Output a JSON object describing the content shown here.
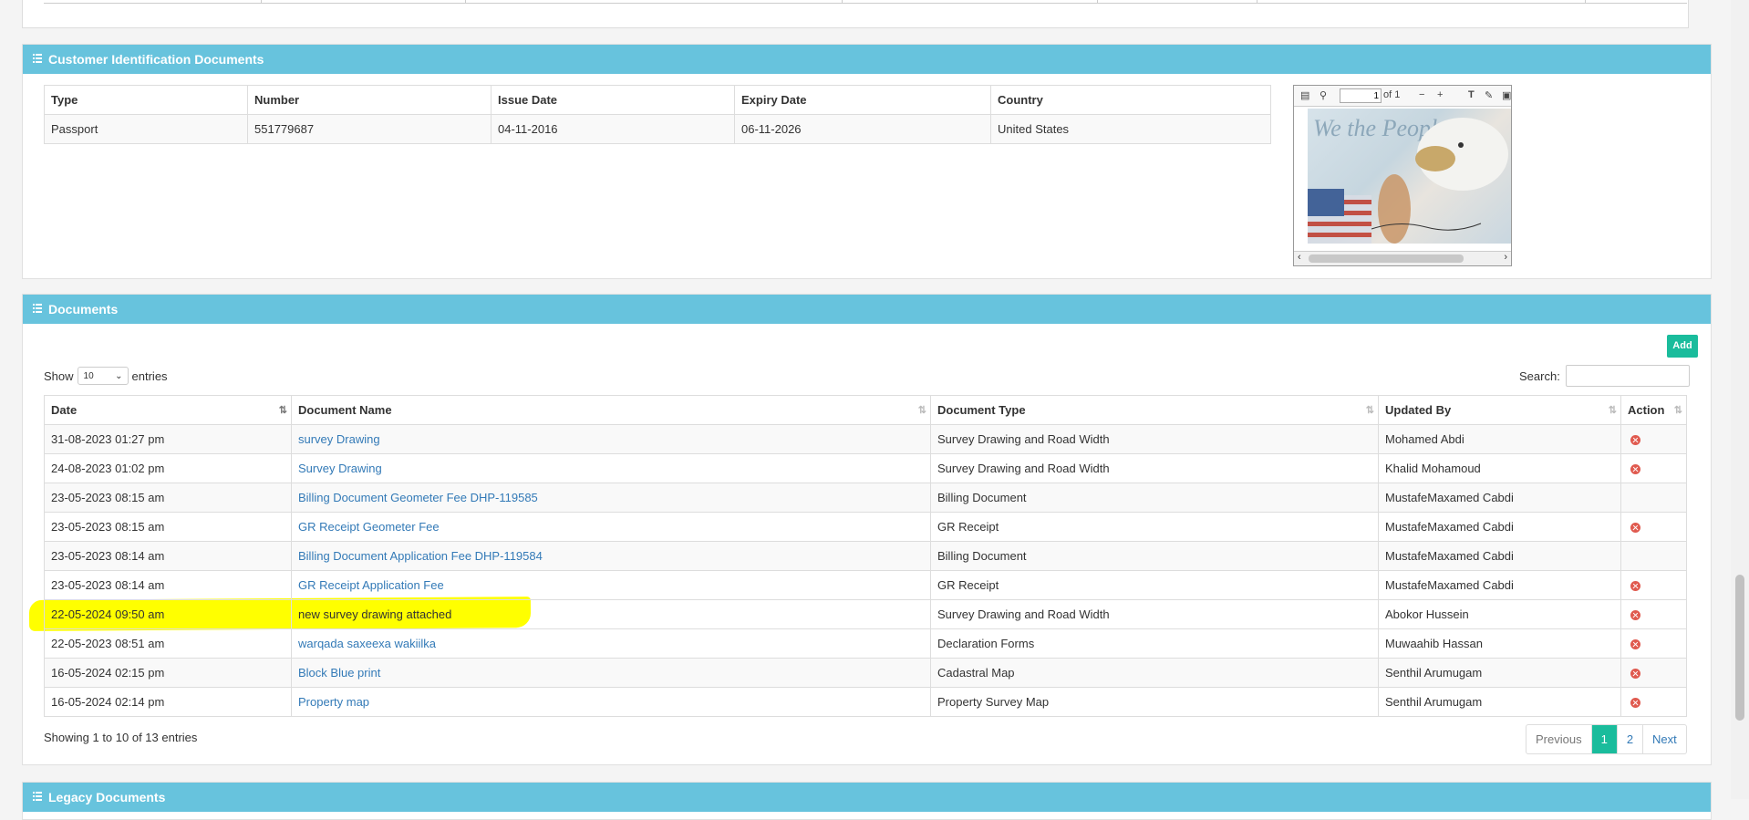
{
  "id_panel": {
    "title": "Customer Identification Documents",
    "columns": [
      "Type",
      "Number",
      "Issue Date",
      "Expiry Date",
      "Country"
    ],
    "rows": [
      [
        "Passport",
        "551779687",
        "04-11-2016",
        "06-11-2026",
        "United States"
      ]
    ]
  },
  "pdf_viewer": {
    "page_input": "1",
    "page_total": "of 1",
    "image_text": "We the People"
  },
  "docs_panel": {
    "title": "Documents",
    "add_label": "Add",
    "show_label": "Show",
    "entries_label": "entries",
    "page_size": "10",
    "search_label": "Search:",
    "search_value": "",
    "columns": [
      "Date",
      "Document Name",
      "Document Type",
      "Updated By",
      "Action"
    ],
    "rows": [
      {
        "date": "31-08-2023 01:27 pm",
        "name": "survey Drawing",
        "type": "Survey Drawing and Road Width",
        "by": "Mohamed Abdi",
        "delete": true
      },
      {
        "date": "24-08-2023 01:02 pm",
        "name": "Survey Drawing",
        "type": "Survey Drawing and Road Width",
        "by": "Khalid Mohamoud",
        "delete": true
      },
      {
        "date": "23-05-2023 08:15 am",
        "name": "Billing Document Geometer Fee DHP-119585",
        "type": "Billing Document",
        "by": "MustafeMaxamed Cabdi",
        "delete": false
      },
      {
        "date": "23-05-2023 08:15 am",
        "name": "GR Receipt Geometer Fee",
        "type": "GR Receipt",
        "by": "MustafeMaxamed Cabdi",
        "delete": true
      },
      {
        "date": "23-05-2023 08:14 am",
        "name": "Billing Document Application Fee DHP-119584",
        "type": "Billing Document",
        "by": "MustafeMaxamed Cabdi",
        "delete": false
      },
      {
        "date": "23-05-2023 08:14 am",
        "name": "GR Receipt Application Fee",
        "type": "GR Receipt",
        "by": "MustafeMaxamed Cabdi",
        "delete": true
      },
      {
        "date": "22-05-2024 09:50 am",
        "name": "new survey drawing attached",
        "type": "Survey Drawing and Road Width",
        "by": "Abokor Hussein",
        "delete": true
      },
      {
        "date": "22-05-2023 08:51 am",
        "name": "warqada saxeexa wakiilka",
        "type": "Declaration Forms",
        "by": "Muwaahib Hassan",
        "delete": true
      },
      {
        "date": "16-05-2024 02:15 pm",
        "name": "Block Blue print",
        "type": "Cadastral Map",
        "by": "Senthil Arumugam",
        "delete": true
      },
      {
        "date": "16-05-2024 02:14 pm",
        "name": "Property map",
        "type": "Property Survey Map",
        "by": "Senthil Arumugam",
        "delete": true
      }
    ],
    "info": "Showing 1 to 10 of 13 entries",
    "pager": {
      "previous": "Previous",
      "pages": [
        "1",
        "2"
      ],
      "next": "Next"
    }
  },
  "legacy_panel": {
    "title": "Legacy Documents"
  },
  "colors": {
    "panel_header": "#67c3dd",
    "accent": "#1abc9c",
    "link": "#337ab7",
    "delete": "#e05a4f",
    "highlight": "#ffff00"
  }
}
